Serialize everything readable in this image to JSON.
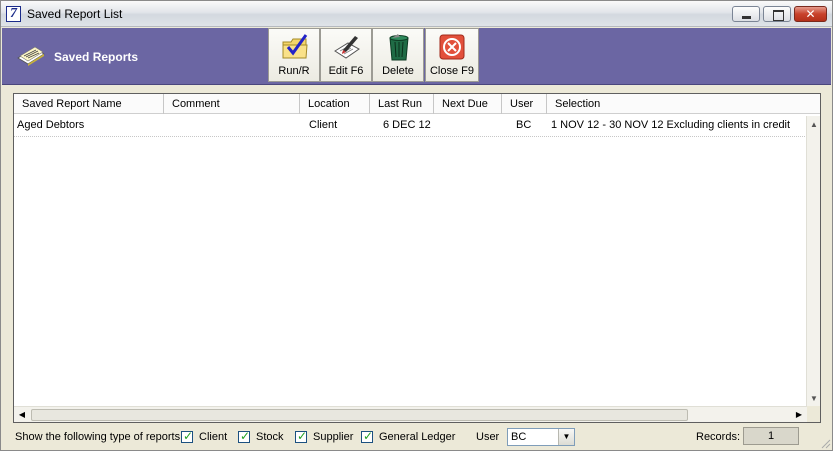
{
  "window": {
    "title": "Saved Report List",
    "app_icon_glyph": "7",
    "controls": {
      "minimize": "",
      "maximize": "",
      "close": "✕"
    }
  },
  "header": {
    "title": "Saved Reports",
    "icon": "report-papers-icon",
    "background": "#6b66a3"
  },
  "toolbar": [
    {
      "id": "run",
      "label": "Run/R",
      "icon": "folder-check-icon"
    },
    {
      "id": "edit",
      "label": "Edit F6",
      "icon": "edit-pencil-icon"
    },
    {
      "id": "delete",
      "label": "Delete",
      "icon": "trash-bin-icon"
    },
    {
      "id": "close",
      "label": "Close F9",
      "icon": "close-circle-icon"
    }
  ],
  "grid": {
    "columns": [
      "Saved Report Name",
      "Comment",
      "Location",
      "Last Run",
      "Next Due",
      "User",
      "Selection"
    ],
    "rows": [
      {
        "name": "Aged Debtors",
        "comment": "",
        "location": "Client",
        "last_run": "6 DEC 12",
        "next_due": "",
        "user": "BC",
        "selection": "1 NOV 12 - 30 NOV 12  Excluding clients in credit"
      }
    ]
  },
  "footer": {
    "show_label": "Show the following type of reports",
    "filters": [
      {
        "label": "Client",
        "checked": true
      },
      {
        "label": "Stock",
        "checked": true
      },
      {
        "label": "Supplier",
        "checked": true
      },
      {
        "label": "General Ledger",
        "checked": true
      }
    ],
    "user_label": "User",
    "user_value": "BC",
    "records_label": "Records:",
    "records_value": "1"
  }
}
